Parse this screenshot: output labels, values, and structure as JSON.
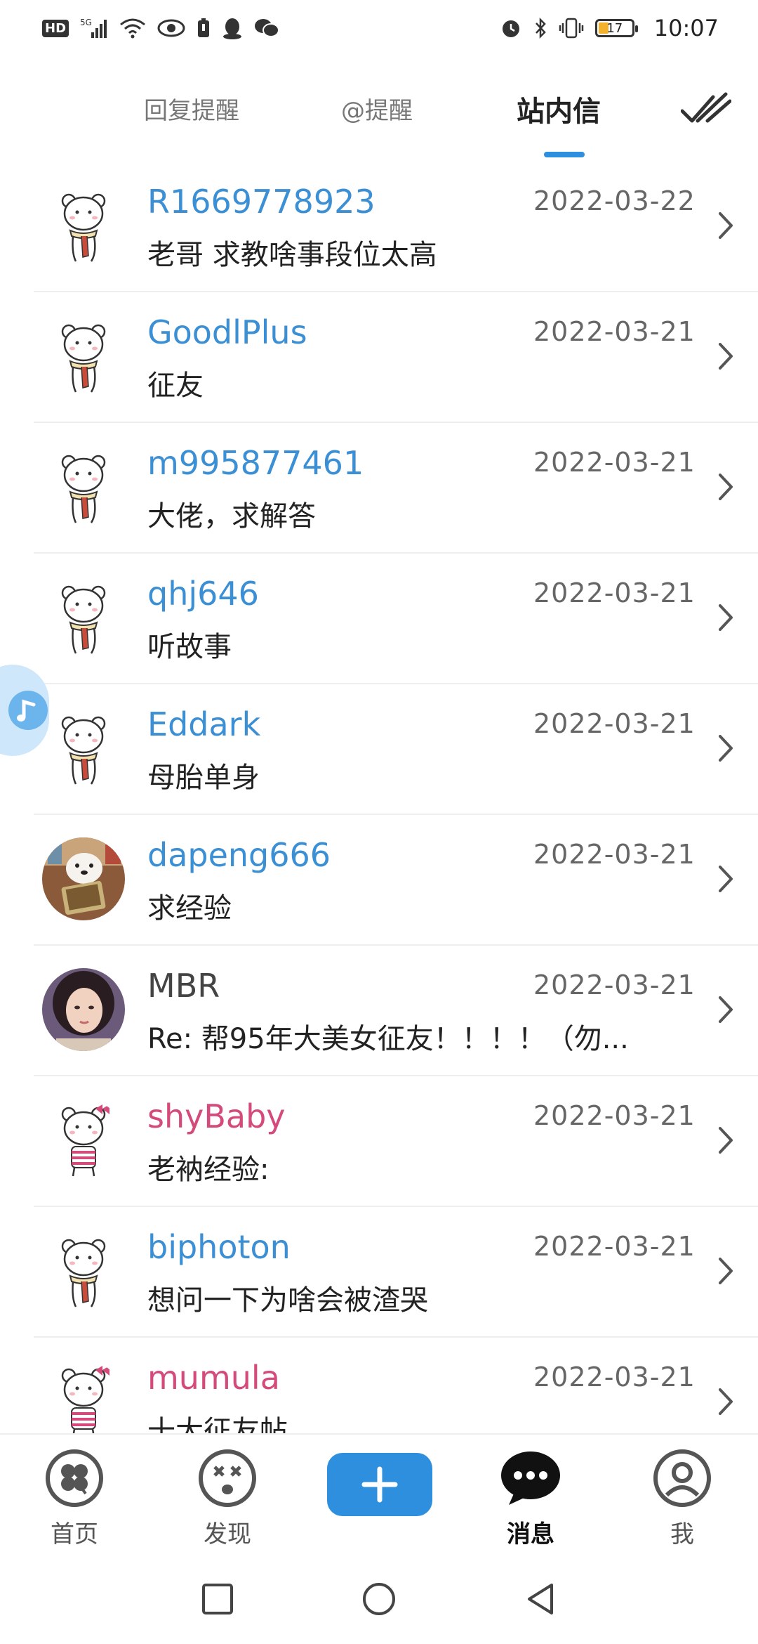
{
  "status_bar": {
    "hd": "HD",
    "signal": "5G",
    "battery": "17",
    "time": "10:07"
  },
  "tabs": [
    {
      "label": "回复提醒",
      "active": false
    },
    {
      "label": "@提醒",
      "active": false
    },
    {
      "label": "站内信",
      "active": true
    }
  ],
  "messages": [
    {
      "user": "R1669778923",
      "date": "2022-03-22",
      "preview": "老哥 求教啥事段位太高",
      "avatar": "bear-scarf",
      "name_color": "blue"
    },
    {
      "user": "GoodlPlus",
      "date": "2022-03-21",
      "preview": "征友",
      "avatar": "bear-scarf",
      "name_color": "blue"
    },
    {
      "user": "m995877461",
      "date": "2022-03-21",
      "preview": "大佬，求解答",
      "avatar": "bear-scarf",
      "name_color": "blue"
    },
    {
      "user": "qhj646",
      "date": "2022-03-21",
      "preview": "听故事",
      "avatar": "bear-scarf",
      "name_color": "blue"
    },
    {
      "user": "Eddark",
      "date": "2022-03-21",
      "preview": "母胎单身",
      "avatar": "bear-scarf",
      "name_color": "blue"
    },
    {
      "user": "dapeng666",
      "date": "2022-03-21",
      "preview": "求经验",
      "avatar": "polar-bear-photo",
      "name_color": "blue"
    },
    {
      "user": "MBR",
      "date": "2022-03-21",
      "preview": "Re: 帮95年大美女征友！！！！（勿...",
      "avatar": "woman-photo",
      "name_color": "dark"
    },
    {
      "user": "shyBaby",
      "date": "2022-03-21",
      "preview": "老衲经验:",
      "avatar": "bear-bow",
      "name_color": "pink"
    },
    {
      "user": "biphoton",
      "date": "2022-03-21",
      "preview": "想问一下为啥会被渣哭",
      "avatar": "bear-scarf",
      "name_color": "blue"
    },
    {
      "user": "mumula",
      "date": "2022-03-21",
      "preview": "十大征友帖",
      "avatar": "bear-bow",
      "name_color": "pink"
    }
  ],
  "bottom_nav": [
    {
      "label": "首页",
      "icon": "clover-icon",
      "active": false
    },
    {
      "label": "发现",
      "icon": "dizzy-face-icon",
      "active": false
    },
    {
      "label": "",
      "icon": "plus-icon",
      "active": false
    },
    {
      "label": "消息",
      "icon": "chat-bubble-icon",
      "active": true
    },
    {
      "label": "我",
      "icon": "profile-icon",
      "active": false
    }
  ],
  "colors": {
    "accent": "#2e8fde",
    "username_blue": "#3b8fd4",
    "username_pink": "#d44a7a"
  }
}
